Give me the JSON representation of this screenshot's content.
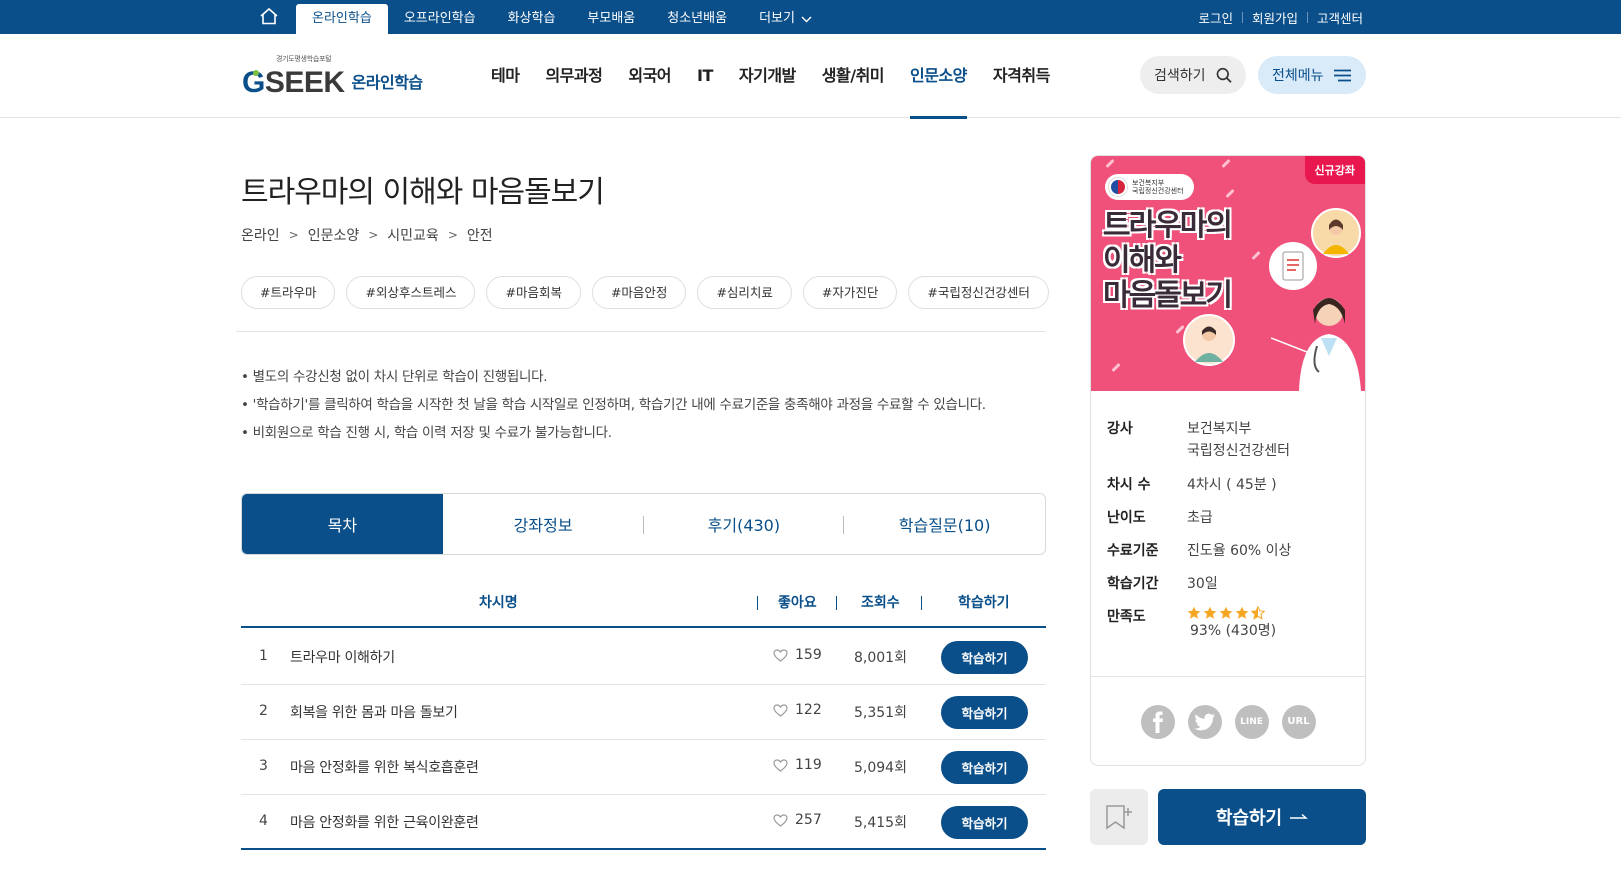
{
  "topbar": {
    "tabs": [
      {
        "label": "온라인학습",
        "active": true
      },
      {
        "label": "오프라인학습"
      },
      {
        "label": "화상학습"
      },
      {
        "label": "부모배움"
      },
      {
        "label": "청소년배움"
      },
      {
        "label": "더보기"
      }
    ],
    "util": {
      "login": "로그인",
      "signup": "회원가입",
      "support": "고객센터"
    }
  },
  "header": {
    "logo_tagline": "경기도평생학습포털",
    "logo_mark": "SEEK",
    "logo_sub": "온라인학습",
    "gnb": [
      "테마",
      "의무과정",
      "외국어",
      "IT",
      "자기개발",
      "생활/취미",
      "인문소양",
      "자격취득"
    ],
    "gnb_active": "인문소양",
    "search_label": "검색하기",
    "menu_label": "전체메뉴"
  },
  "course": {
    "title": "트라우마의 이해와 마음돌보기",
    "breadcrumb": [
      "온라인",
      "인문소양",
      "시민교육",
      "안전"
    ],
    "tags": [
      "#트라우마",
      "#외상후스트레스",
      "#마음회복",
      "#마음안정",
      "#심리치료",
      "#자가진단",
      "#국립정신건강센터"
    ],
    "notes": [
      "별도의 수강신청 없이 차시 단위로 학습이 진행됩니다.",
      "'학습하기'를 클릭하여 학습을 시작한 첫 날을 학습 시작일로 인정하며, 학습기간 내에 수료기준을 충족해야 과정을 수료할 수 있습니다.",
      "비회원으로 학습 진행 시, 학습 이력 저장 및 수료가 불가능합니다."
    ]
  },
  "tabs": [
    {
      "label": "목차",
      "active": true
    },
    {
      "label": "강좌정보"
    },
    {
      "label": "후기(430)"
    },
    {
      "label": "학습질문(10)"
    }
  ],
  "table": {
    "headers": {
      "name": "차시명",
      "likes": "좋아요",
      "views": "조회수",
      "action": "학습하기"
    },
    "rows": [
      {
        "no": "1",
        "name": "트라우마 이해하기",
        "likes": "159",
        "views": "8,001회",
        "btn": "학습하기"
      },
      {
        "no": "2",
        "name": "회복을 위한 몸과 마음 돌보기",
        "likes": "122",
        "views": "5,351회",
        "btn": "학습하기"
      },
      {
        "no": "3",
        "name": "마음 안정화를 위한 복식호흡훈련",
        "likes": "119",
        "views": "5,094회",
        "btn": "학습하기"
      },
      {
        "no": "4",
        "name": "마음 안정화를 위한 근육이완훈련",
        "likes": "257",
        "views": "5,415회",
        "btn": "학습하기"
      }
    ]
  },
  "card": {
    "badge": "신규강좌",
    "org_line1": "보건복지부",
    "org_line2": "국립정신건강센터",
    "thumb_title_1": "트라우마의",
    "thumb_title_2": "이해와",
    "thumb_title_3": "마음돌보기",
    "info": [
      {
        "key": "강사",
        "value": "보건복지부",
        "value2": "국립정신건강센터"
      },
      {
        "key": "차시 수",
        "value": "4차시 ( 45분 )"
      },
      {
        "key": "난이도",
        "value": "초급"
      },
      {
        "key": "수료기준",
        "value": "진도율 60% 이상"
      },
      {
        "key": "학습기간",
        "value": "30일"
      },
      {
        "key": "만족도",
        "value": "93% (430명)",
        "rating": 4.5
      }
    ],
    "sns": [
      "facebook",
      "twitter",
      "LINE",
      "URL"
    ]
  },
  "cta": {
    "label": "학습하기"
  },
  "colors": {
    "primary": "#0a4f8a",
    "thumb_bg": "#f0517a",
    "badge": "#e8184f",
    "star": "#f5a623"
  }
}
